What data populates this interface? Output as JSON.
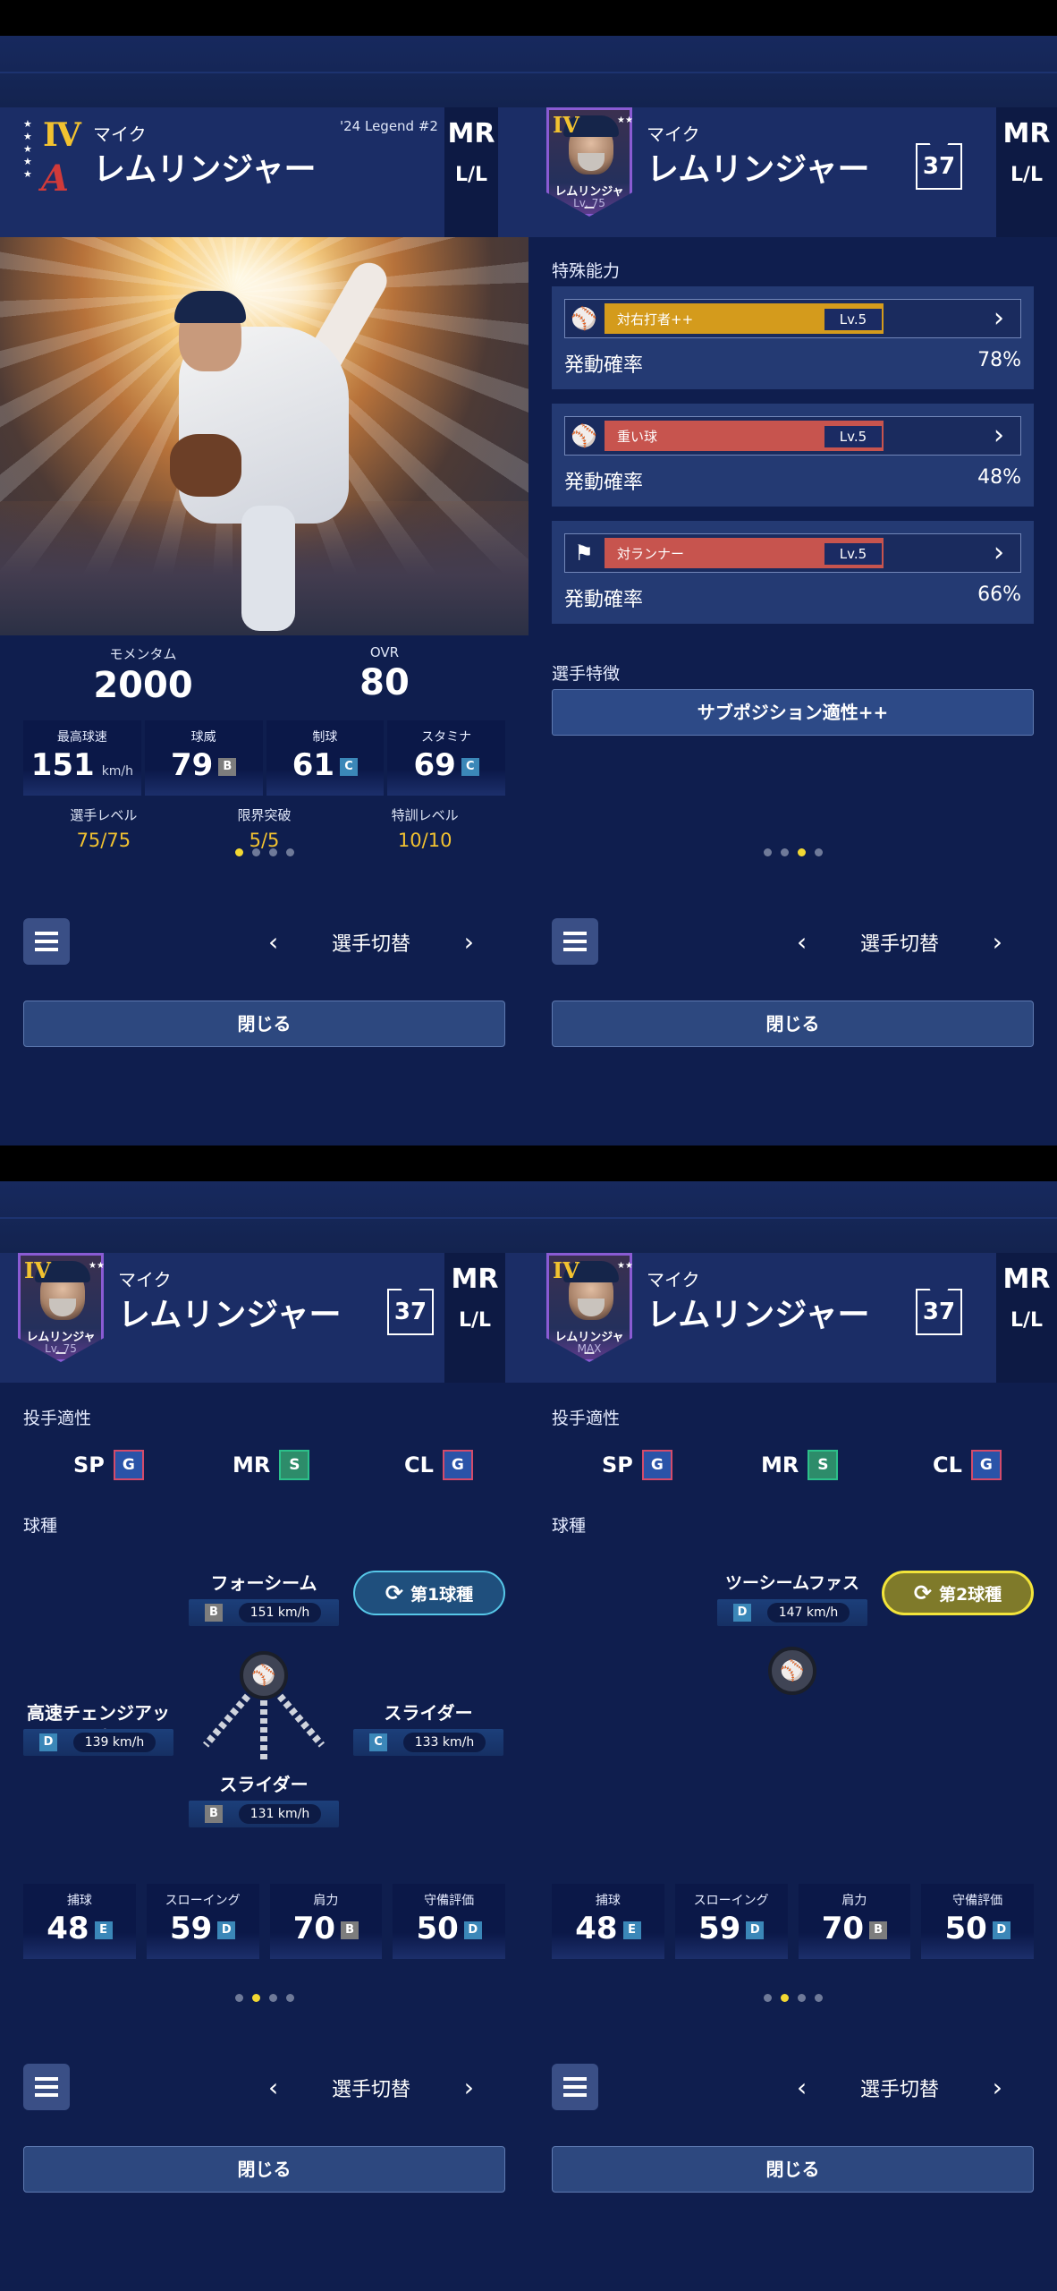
{
  "player": {
    "first_name": "マイク",
    "last_name": "レムリンジャー",
    "grade": "IV",
    "edition": "'24 Legend #2",
    "position": "MR",
    "handedness": "L/L",
    "number": "37",
    "card_name": "レムリンジャー",
    "card_level": "Lv. 75",
    "card_level_max": "MAX"
  },
  "panel1": {
    "momentum_label": "モメンタム",
    "momentum_value": "2000",
    "ovr_label": "OVR",
    "ovr_value": "80",
    "stats": [
      {
        "label": "最高球速",
        "value": "151",
        "unit": "km/h",
        "rank": ""
      },
      {
        "label": "球威",
        "value": "79",
        "rank": "B"
      },
      {
        "label": "制球",
        "value": "61",
        "rank": "C"
      },
      {
        "label": "スタミナ",
        "value": "69",
        "rank": "C"
      }
    ],
    "levels": [
      {
        "label": "選手レベル",
        "value": "75/75"
      },
      {
        "label": "限界突破",
        "value": "5/5"
      },
      {
        "label": "特訓レベル",
        "value": "10/10"
      }
    ]
  },
  "panel2": {
    "special_title": "特殊能力",
    "abilities": [
      {
        "name": "対右打者++",
        "level": "Lv.5",
        "rate_label": "発動確率",
        "rate": "78%",
        "color": "#d49b1c",
        "icon": "batter-icon"
      },
      {
        "name": "重い球",
        "level": "Lv.5",
        "rate_label": "発動確率",
        "rate": "48%",
        "color": "#c7544e",
        "icon": "heavy-ball-icon"
      },
      {
        "name": "対ランナー",
        "level": "Lv.5",
        "rate_label": "発動確率",
        "rate": "66%",
        "color": "#c7544e",
        "icon": "runner-icon"
      }
    ],
    "feature_title": "選手特徴",
    "feature_button": "サブポジション適性++"
  },
  "aptitude": {
    "title": "投手適性",
    "items": [
      {
        "pos": "SP",
        "rank": "G"
      },
      {
        "pos": "MR",
        "rank": "S"
      },
      {
        "pos": "CL",
        "rank": "G"
      }
    ]
  },
  "pitch_title": "球種",
  "panel3": {
    "tag": "第1球種",
    "pitches": [
      {
        "name": "フォーシーム",
        "rank": "B",
        "speed": "151 km/h"
      },
      {
        "name": "高速チェンジアップ",
        "rank": "D",
        "speed": "139 km/h"
      },
      {
        "name": "スライダー",
        "rank": "C",
        "speed": "133 km/h"
      },
      {
        "name": "スライダー",
        "rank": "B",
        "speed": "131 km/h"
      }
    ]
  },
  "panel4": {
    "tag": "第2球種",
    "pitches": [
      {
        "name": "ツーシームファスト",
        "rank": "D",
        "speed": "147 km/h"
      }
    ]
  },
  "fielding": [
    {
      "label": "捕球",
      "value": "48",
      "rank": "E"
    },
    {
      "label": "スローイング",
      "value": "59",
      "rank": "D"
    },
    {
      "label": "肩力",
      "value": "70",
      "rank": "B"
    },
    {
      "label": "守備評価",
      "value": "50",
      "rank": "D"
    }
  ],
  "nav": {
    "switch_label": "選手切替",
    "prev": "‹",
    "next": "›",
    "close_label": "閉じる"
  },
  "pager": {
    "panel1_active": 0,
    "panel2_active": 2,
    "panel3_active": 1,
    "panel4_active": 1,
    "count": 4
  },
  "colors": {
    "background": "#0f1e4e",
    "accent_gold": "#f2c230",
    "rank_S": "#2d8c6a",
    "rank_G_border": "#d44b6a"
  }
}
